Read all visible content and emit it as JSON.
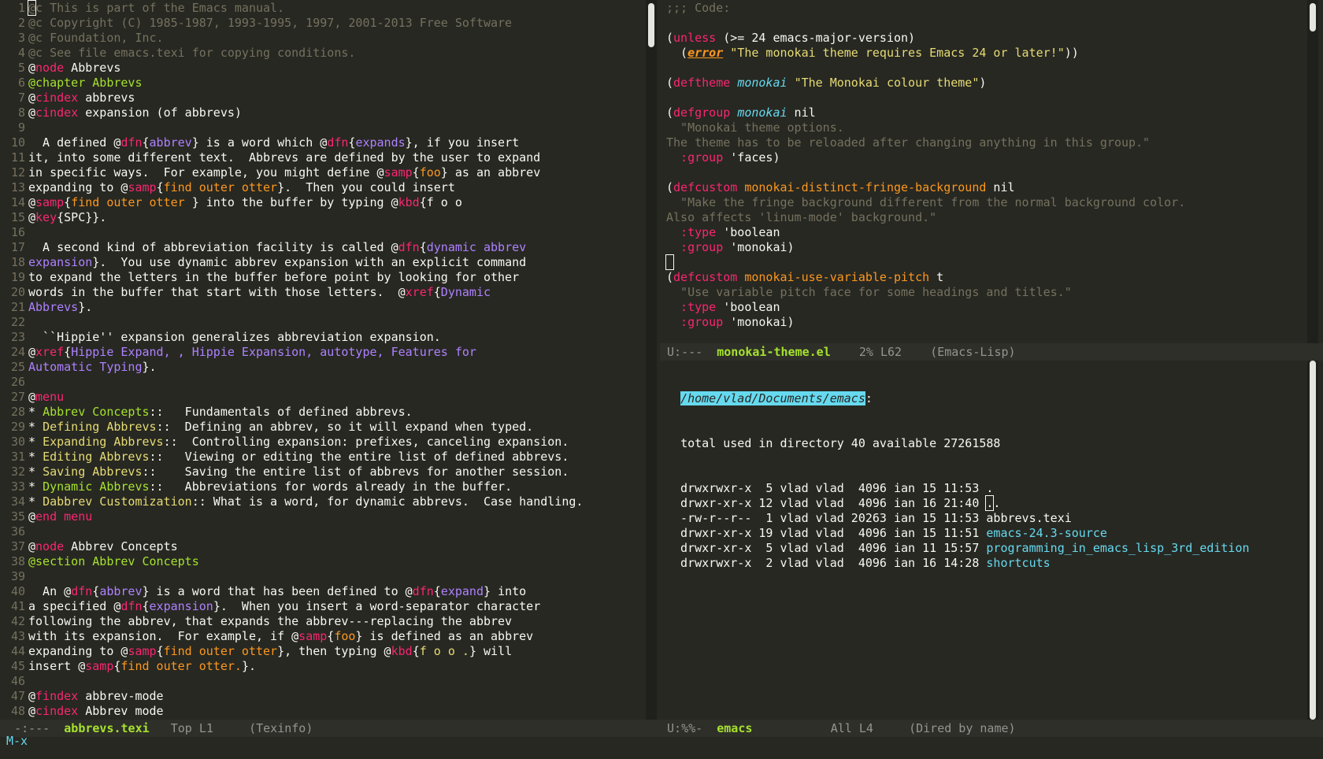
{
  "left": {
    "line_numbers": [
      "1",
      "2",
      "3",
      "4",
      "5",
      "6",
      "7",
      "8",
      "9",
      "10",
      "11",
      "12",
      "13",
      "14",
      "15",
      "16",
      "17",
      "18",
      "19",
      "20",
      "21",
      "22",
      "23",
      "24",
      "25",
      "26",
      "27",
      "28",
      "29",
      "30",
      "31",
      "32",
      "33",
      "34",
      "35",
      "36",
      "37",
      "38",
      "39",
      "40",
      "41",
      "42",
      "43",
      "44",
      "45",
      "46",
      "47",
      "48"
    ],
    "lines": [
      [
        [
          "cm",
          "@c This is part of the Emacs manual."
        ]
      ],
      [
        [
          "cm",
          "@c Copyright (C) 1985-1987, 1993-1995, 1997, 2001-2013 Free Software"
        ]
      ],
      [
        [
          "cm",
          "@c Foundation, Inc."
        ]
      ],
      [
        [
          "cm",
          "@c See file emacs.texi for copying conditions."
        ]
      ],
      [
        [
          "",
          "@"
        ],
        [
          "kw",
          "node"
        ],
        [
          "",
          " Abbrevs"
        ]
      ],
      [
        [
          "fn",
          "@chapter Abbrevs"
        ]
      ],
      [
        [
          "",
          "@"
        ],
        [
          "kw",
          "cindex"
        ],
        [
          "",
          " abbrevs"
        ]
      ],
      [
        [
          "",
          "@"
        ],
        [
          "kw",
          "cindex"
        ],
        [
          "",
          " expansion (of abbrevs)"
        ]
      ],
      [
        [
          "",
          ""
        ]
      ],
      [
        [
          "",
          "  A defined @"
        ],
        [
          "kw",
          "dfn"
        ],
        [
          "",
          "{"
        ],
        [
          "pu",
          "abbrev"
        ],
        [
          "",
          "} is a word which @"
        ],
        [
          "kw",
          "dfn"
        ],
        [
          "",
          "{"
        ],
        [
          "pu",
          "expands"
        ],
        [
          "",
          "}, if you insert"
        ]
      ],
      [
        [
          "",
          "it, into some different text.  Abbrevs are defined by the user to expand"
        ]
      ],
      [
        [
          "",
          "in specific ways.  For example, you might define @"
        ],
        [
          "kw",
          "samp"
        ],
        [
          "",
          "{"
        ],
        [
          "or",
          "foo"
        ],
        [
          "",
          "} as an abbrev"
        ]
      ],
      [
        [
          "",
          "expanding to @"
        ],
        [
          "kw",
          "samp"
        ],
        [
          "",
          "{"
        ],
        [
          "or",
          "find outer otter"
        ],
        [
          "",
          "}.  Then you could insert"
        ]
      ],
      [
        [
          "",
          "@"
        ],
        [
          "kw",
          "samp"
        ],
        [
          "",
          "{"
        ],
        [
          "or",
          "find outer otter "
        ],
        [
          "",
          "} into the buffer by typing @"
        ],
        [
          "kw",
          "kbd"
        ],
        [
          "",
          "{f o o"
        ]
      ],
      [
        [
          "",
          "@"
        ],
        [
          "kw",
          "key"
        ],
        [
          "",
          "{SPC}}."
        ]
      ],
      [
        [
          "",
          ""
        ]
      ],
      [
        [
          "",
          "  A second kind of abbreviation facility is called @"
        ],
        [
          "kw",
          "dfn"
        ],
        [
          "",
          "{"
        ],
        [
          "pu",
          "dynamic abbrev"
        ]
      ],
      [
        [
          "pu",
          "expansion"
        ],
        [
          "",
          "}.  You use dynamic abbrev expansion with an explicit command"
        ]
      ],
      [
        [
          "",
          "to expand the letters in the buffer before point by looking for other"
        ]
      ],
      [
        [
          "",
          "words in the buffer that start with those letters.  @"
        ],
        [
          "kw",
          "xref"
        ],
        [
          "",
          "{"
        ],
        [
          "pu",
          "Dynamic"
        ]
      ],
      [
        [
          "pu",
          "Abbrevs"
        ],
        [
          "",
          "}."
        ]
      ],
      [
        [
          "",
          ""
        ]
      ],
      [
        [
          "",
          "  ``Hippie'' expansion generalizes abbreviation expansion."
        ]
      ],
      [
        [
          "",
          "@"
        ],
        [
          "kw",
          "xref"
        ],
        [
          "",
          "{"
        ],
        [
          "pu",
          "Hippie Expand, , Hippie Expansion, autotype, Features for"
        ]
      ],
      [
        [
          "pu",
          "Automatic Typing"
        ],
        [
          "",
          "}."
        ]
      ],
      [
        [
          "",
          ""
        ]
      ],
      [
        [
          "",
          "@"
        ],
        [
          "kw",
          "menu"
        ]
      ],
      [
        [
          "",
          "* "
        ],
        [
          "fn",
          "Abbrev Concepts"
        ],
        [
          "",
          "::   Fundamentals of defined abbrevs."
        ]
      ],
      [
        [
          "",
          "* "
        ],
        [
          "st",
          "Defining Abbrevs"
        ],
        [
          "",
          "::  Defining an abbrev, so it will expand when typed."
        ]
      ],
      [
        [
          "",
          "* "
        ],
        [
          "st",
          "Expanding Abbrevs"
        ],
        [
          "",
          "::  Controlling expansion: prefixes, canceling expansion."
        ]
      ],
      [
        [
          "",
          "* "
        ],
        [
          "st",
          "Editing Abbrevs"
        ],
        [
          "",
          "::   Viewing or editing the entire list of defined abbrevs."
        ]
      ],
      [
        [
          "",
          "* "
        ],
        [
          "st",
          "Saving Abbrevs"
        ],
        [
          "",
          "::    Saving the entire list of abbrevs for another session."
        ]
      ],
      [
        [
          "",
          "* "
        ],
        [
          "fn",
          "Dynamic Abbrevs"
        ],
        [
          "",
          "::   Abbreviations for words already in the buffer."
        ]
      ],
      [
        [
          "",
          "* "
        ],
        [
          "st",
          "Dabbrev Customization"
        ],
        [
          "",
          ":: What is a word, for dynamic abbrevs.  Case handling."
        ]
      ],
      [
        [
          "",
          "@"
        ],
        [
          "kw",
          "end menu"
        ]
      ],
      [
        [
          "",
          ""
        ]
      ],
      [
        [
          "",
          "@"
        ],
        [
          "kw",
          "node"
        ],
        [
          "",
          " Abbrev Concepts"
        ]
      ],
      [
        [
          "fn",
          "@section Abbrev Concepts"
        ]
      ],
      [
        [
          "",
          ""
        ]
      ],
      [
        [
          "",
          "  An @"
        ],
        [
          "kw",
          "dfn"
        ],
        [
          "",
          "{"
        ],
        [
          "pu",
          "abbrev"
        ],
        [
          "",
          "} is a word that has been defined to @"
        ],
        [
          "kw",
          "dfn"
        ],
        [
          "",
          "{"
        ],
        [
          "pu",
          "expand"
        ],
        [
          "",
          "} into"
        ]
      ],
      [
        [
          "",
          "a specified @"
        ],
        [
          "kw",
          "dfn"
        ],
        [
          "",
          "{"
        ],
        [
          "pu",
          "expansion"
        ],
        [
          "",
          "}.  When you insert a word-separator character"
        ]
      ],
      [
        [
          "",
          "following the abbrev, that expands the abbrev---replacing the abbrev"
        ]
      ],
      [
        [
          "",
          "with its expansion.  For example, if @"
        ],
        [
          "kw",
          "samp"
        ],
        [
          "",
          "{"
        ],
        [
          "or",
          "foo"
        ],
        [
          "",
          "} is defined as an abbrev"
        ]
      ],
      [
        [
          "",
          "expanding to @"
        ],
        [
          "kw",
          "samp"
        ],
        [
          "",
          "{"
        ],
        [
          "or",
          "find outer otter"
        ],
        [
          "",
          "}, then typing @"
        ],
        [
          "kw",
          "kbd"
        ],
        [
          "",
          "{"
        ],
        [
          "st",
          "f o o ."
        ],
        [
          "",
          "} will"
        ]
      ],
      [
        [
          "",
          "insert @"
        ],
        [
          "kw",
          "samp"
        ],
        [
          "",
          "{"
        ],
        [
          "or",
          "find outer otter."
        ],
        [
          "",
          "}."
        ]
      ],
      [
        [
          "",
          ""
        ]
      ],
      [
        [
          "",
          "@"
        ],
        [
          "kw",
          "findex"
        ],
        [
          "",
          " abbrev-mode"
        ]
      ],
      [
        [
          "",
          "@"
        ],
        [
          "kw",
          "cindex"
        ],
        [
          "",
          " Abbrev mode"
        ]
      ]
    ],
    "modeline": {
      "state": "-:---",
      "buffer": "abbrevs.texi",
      "position": "Top L1",
      "mode": "(Texinfo)"
    }
  },
  "right_top": {
    "lines": [
      [
        [
          "cm",
          ";;; Code:"
        ]
      ],
      [
        [
          "",
          ""
        ]
      ],
      [
        [
          "",
          "("
        ],
        [
          "kw",
          "unless"
        ],
        [
          "",
          " (>= 24 emacs-major-version)"
        ]
      ],
      [
        [
          "",
          "  ("
        ],
        [
          "err",
          "error"
        ],
        [
          "",
          " "
        ],
        [
          "st",
          "\"The monokai theme requires Emacs 24 or later!\""
        ],
        [
          "",
          "))"
        ]
      ],
      [
        [
          "",
          ""
        ]
      ],
      [
        [
          "",
          "("
        ],
        [
          "kw",
          "deftheme"
        ],
        [
          "",
          " "
        ],
        [
          "ty",
          "monokai"
        ],
        [
          "",
          " "
        ],
        [
          "st",
          "\"The Monokai colour theme\""
        ],
        [
          "",
          ")"
        ]
      ],
      [
        [
          "",
          ""
        ]
      ],
      [
        [
          "",
          "("
        ],
        [
          "kw",
          "defgroup"
        ],
        [
          "",
          " "
        ],
        [
          "ty",
          "monokai"
        ],
        [
          "",
          " nil"
        ]
      ],
      [
        [
          "ds",
          "  \"Monokai theme options."
        ]
      ],
      [
        [
          "ds",
          "The theme has to be reloaded after changing anything in this group.\""
        ]
      ],
      [
        [
          "kw",
          "  :group"
        ],
        [
          "",
          " 'faces)"
        ]
      ],
      [
        [
          "",
          ""
        ]
      ],
      [
        [
          "",
          "("
        ],
        [
          "kw",
          "defcustom"
        ],
        [
          "",
          " "
        ],
        [
          "or",
          "monokai-distinct-fringe-background"
        ],
        [
          "",
          " nil"
        ]
      ],
      [
        [
          "ds",
          "  \"Make the fringe background different from the normal background color."
        ]
      ],
      [
        [
          "ds",
          "Also affects 'linum-mode' background.\""
        ]
      ],
      [
        [
          "kw",
          "  :type"
        ],
        [
          "",
          " 'boolean"
        ]
      ],
      [
        [
          "kw",
          "  :group"
        ],
        [
          "",
          " 'monokai)"
        ]
      ],
      [
        [
          "cur",
          " "
        ]
      ],
      [
        [
          "",
          "("
        ],
        [
          "kw",
          "defcustom"
        ],
        [
          "",
          " "
        ],
        [
          "or",
          "monokai-use-variable-pitch"
        ],
        [
          "",
          " t"
        ]
      ],
      [
        [
          "ds",
          "  \"Use variable pitch face for some headings and titles.\""
        ]
      ],
      [
        [
          "kw",
          "  :type"
        ],
        [
          "",
          " 'boolean"
        ]
      ],
      [
        [
          "kw",
          "  :group"
        ],
        [
          "",
          " 'monokai)"
        ]
      ]
    ],
    "modeline": {
      "state": "U:---",
      "buffer": "monokai-theme.el",
      "position": "2% L62",
      "mode": "(Emacs-Lisp)"
    }
  },
  "right_bottom": {
    "directory": "/home/vlad/Documents/emacs",
    "total_line": "total used in directory 40 available 27261588",
    "entries": [
      {
        "perms": "drwxrwxr-x",
        "links": " 5",
        "owner": "vlad",
        "group": "vlad",
        "size": " 4096",
        "date": "ian 15 11:53",
        "name": ".",
        "kind": "plain"
      },
      {
        "perms": "drwxr-xr-x",
        "links": "12",
        "owner": "vlad",
        "group": "vlad",
        "size": " 4096",
        "date": "ian 16 21:40",
        "name": "..",
        "kind": "cursor"
      },
      {
        "perms": "-rw-r--r--",
        "links": " 1",
        "owner": "vlad",
        "group": "vlad",
        "size": "20263",
        "date": "ian 15 11:53",
        "name": "abbrevs.texi",
        "kind": "plain"
      },
      {
        "perms": "drwxr-xr-x",
        "links": "19",
        "owner": "vlad",
        "group": "vlad",
        "size": " 4096",
        "date": "ian 15 11:51",
        "name": "emacs-24.3-source",
        "kind": "dir"
      },
      {
        "perms": "drwxr-xr-x",
        "links": " 5",
        "owner": "vlad",
        "group": "vlad",
        "size": " 4096",
        "date": "ian 11 15:57",
        "name": "programming_in_emacs_lisp_3rd_edition",
        "kind": "dir"
      },
      {
        "perms": "drwxrwxr-x",
        "links": " 2",
        "owner": "vlad",
        "group": "vlad",
        "size": " 4096",
        "date": "ian 16 14:28",
        "name": "shortcuts",
        "kind": "dir"
      }
    ],
    "modeline": {
      "state": "U:%%-",
      "buffer": "emacs",
      "position": "All L4",
      "mode": "(Dired by name)"
    }
  },
  "minibuffer": {
    "text": "M-x"
  },
  "colors": {
    "background": "#272822",
    "foreground": "#f8f8f2",
    "keyword": "#f92672",
    "function": "#a6e22e",
    "string": "#e6db74",
    "comment": "#75715e",
    "type": "#66d9ef"
  }
}
